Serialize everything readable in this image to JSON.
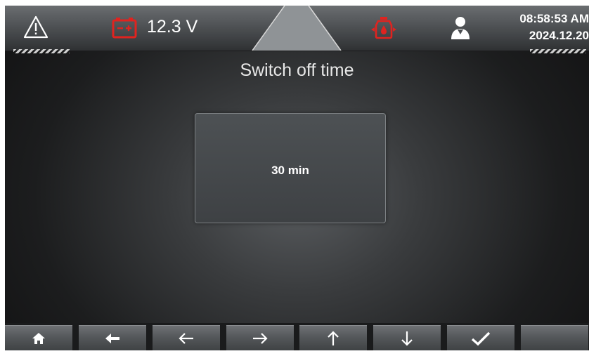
{
  "header": {
    "voltage": "12.3 V",
    "time": "08:58:53 AM",
    "date": "2024.12.20",
    "icons": [
      "warning-icon",
      "battery-icon",
      "oil-pressure-icon",
      "user-icon"
    ],
    "colors": {
      "alert_red": "#e0231f",
      "text": "#ffffff"
    }
  },
  "main": {
    "title": "Switch off time",
    "value": "30 min"
  },
  "toolbar": {
    "buttons": [
      "home-icon",
      "back-icon",
      "arrow-left-icon",
      "arrow-right-icon",
      "arrow-up-icon",
      "arrow-down-icon",
      "check-icon",
      "blank"
    ]
  }
}
